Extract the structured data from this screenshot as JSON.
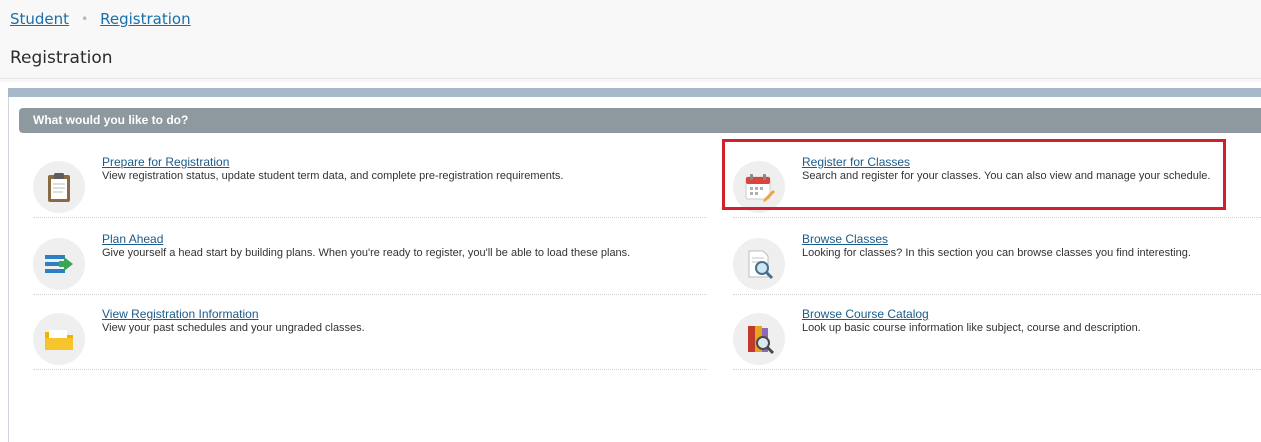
{
  "breadcrumb": {
    "items": [
      "Student",
      "Registration"
    ],
    "separator": "•"
  },
  "page": {
    "title": "Registration"
  },
  "section": {
    "header": "What would you like to do?"
  },
  "options": [
    {
      "title": "Prepare for Registration",
      "description": "View registration status, update student term data, and complete pre-registration requirements.",
      "icon": "clipboard-icon"
    },
    {
      "title": "Register for Classes",
      "description": "Search and register for your classes. You can also view and manage your schedule.",
      "icon": "calendar-pencil-icon"
    },
    {
      "title": "Plan Ahead",
      "description": "Give yourself a head start by building plans. When you're ready to register, you'll be able to load these plans.",
      "icon": "list-arrow-icon"
    },
    {
      "title": "Browse Classes",
      "description": "Looking for classes? In this section you can browse classes you find interesting.",
      "icon": "document-magnifier-icon"
    },
    {
      "title": "View Registration Information",
      "description": "View your past schedules and your ungraded classes.",
      "icon": "folder-icon"
    },
    {
      "title": "Browse Course Catalog",
      "description": "Look up basic course information like subject, course and description.",
      "icon": "book-magnifier-icon"
    }
  ],
  "colors": {
    "link": "#1a6fa8",
    "section_header": "#8d989f",
    "highlight": "#d21f2b"
  }
}
